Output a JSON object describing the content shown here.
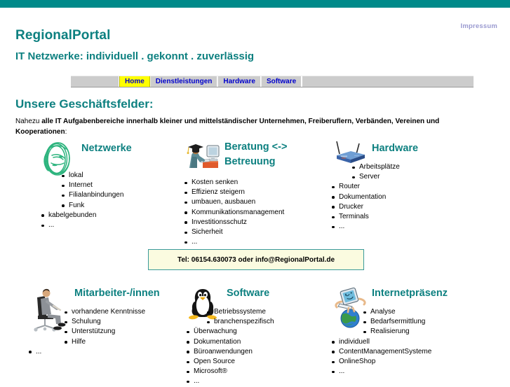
{
  "topbar": {
    "color": "#008a8a"
  },
  "header": {
    "impressum": "Impressum",
    "brand": "RegionalPortal",
    "tagline": "IT Netzwerke: individuell . gekonnt . zuverlässig",
    "brand_color": "#0d8080"
  },
  "nav": {
    "items": [
      {
        "label": "Home",
        "active": true
      },
      {
        "label": "Dienstleistungen",
        "active": false
      },
      {
        "label": "Hardware",
        "active": false
      },
      {
        "label": "Software",
        "active": false
      }
    ],
    "active_bg": "#ffff00",
    "item_bg": "#cccccc",
    "item_color": "#0000cc"
  },
  "main": {
    "section_title": "Unsere Geschäftsfelder:",
    "intro_lead": "Nahezu ",
    "intro_bold": "alle IT Aufgabenbereiche innerhalb kleiner und mittelständischer Unternehmen, Freiberuflern, Verbänden, Vereinen und Kooperationen",
    "intro_tail": ":"
  },
  "cards": [
    {
      "id": "netzwerke",
      "title": "Netzwerke",
      "icon": "network-cable-coil-icon",
      "items": [
        {
          "text": "lokal",
          "indent": true
        },
        {
          "text": "Internet",
          "indent": true
        },
        {
          "text": "Filialanbindungen",
          "indent": true
        },
        {
          "text": "Funk",
          "indent": true
        },
        {
          "text": "kabelgebunden",
          "indent": false
        },
        {
          "text": "...",
          "indent": false
        }
      ]
    },
    {
      "id": "beratung",
      "title": "Beratung <-> Betreuung",
      "icon": "graduate-at-computer-icon",
      "items": [
        {
          "text": "Kosten senken",
          "indent": false
        },
        {
          "text": "Effizienz steigern",
          "indent": false
        },
        {
          "text": "umbauen, ausbauen",
          "indent": false
        },
        {
          "text": "Kommunikationsmanagement",
          "indent": false
        },
        {
          "text": "Investitionsschutz",
          "indent": false
        },
        {
          "text": "Sicherheit",
          "indent": false
        },
        {
          "text": "...",
          "indent": false
        }
      ]
    },
    {
      "id": "hardware",
      "title": "Hardware",
      "icon": "wireless-router-icon",
      "items": [
        {
          "text": "Arbeitsplätze",
          "indent": true
        },
        {
          "text": "Server",
          "indent": true
        },
        {
          "text": "Router",
          "indent": false
        },
        {
          "text": "Dokumentation",
          "indent": false
        },
        {
          "text": "Drucker",
          "indent": false
        },
        {
          "text": "Terminals",
          "indent": false
        },
        {
          "text": "...",
          "indent": false
        }
      ]
    },
    {
      "id": "mitarbeiter",
      "title": "Mitarbeiter-/innen",
      "icon": "person-in-office-chair-icon",
      "items": [
        {
          "text": "vorhandene Kenntnisse",
          "indent": true
        },
        {
          "text": "Schulung",
          "indent": true
        },
        {
          "text": "Unterstützung",
          "indent": true
        },
        {
          "text": "Hilfe",
          "indent": true
        },
        {
          "text": "...",
          "indent": false
        }
      ]
    },
    {
      "id": "software",
      "title": "Software",
      "icon": "linux-penguin-icon",
      "items": [
        {
          "text": "Betriebssysteme",
          "indent": true
        },
        {
          "text": "branchenspezifisch",
          "indent": true
        },
        {
          "text": "Überwachung",
          "indent": false
        },
        {
          "text": "Dokumentation",
          "indent": false
        },
        {
          "text": "Büroanwendungen",
          "indent": false
        },
        {
          "text": "Open Source",
          "indent": false
        },
        {
          "text": "Microsoft®",
          "indent": false
        },
        {
          "text": "...",
          "indent": false
        }
      ]
    },
    {
      "id": "internetpraesenz",
      "title": "Internetpräsenz",
      "icon": "computer-on-globe-icon",
      "items": [
        {
          "text": "Analyse",
          "indent": true
        },
        {
          "text": "Bedarfsermittlung",
          "indent": true
        },
        {
          "text": "Realisierung",
          "indent": true
        },
        {
          "text": "individuell",
          "indent": false
        },
        {
          "text": "ContentManagementSysteme",
          "indent": false
        },
        {
          "text": "OnlineShop",
          "indent": false
        },
        {
          "text": "...",
          "indent": false
        }
      ]
    }
  ],
  "contact": {
    "text": "Tel: 06154.630073 oder info@RegionalPortal.de",
    "bg": "#fbfbe0",
    "border": "#3a9a9a"
  }
}
